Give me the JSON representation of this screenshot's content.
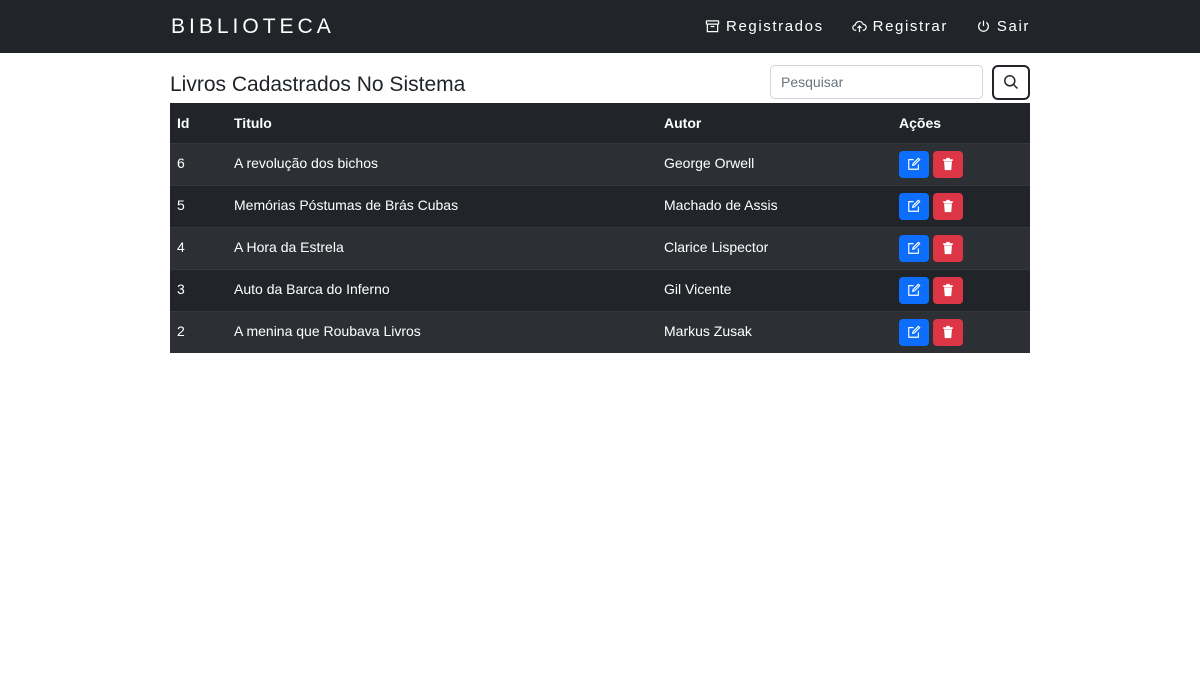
{
  "navbar": {
    "brand": "BIBLIOTECA",
    "links": [
      {
        "label": "Registrados",
        "icon": "archive-icon"
      },
      {
        "label": "Registrar",
        "icon": "cloud-upload-icon"
      },
      {
        "label": "Sair",
        "icon": "power-icon"
      }
    ]
  },
  "main": {
    "title": "Livros Cadastrados No Sistema",
    "search": {
      "placeholder": "Pesquisar",
      "value": ""
    }
  },
  "table": {
    "headers": {
      "id": "Id",
      "title": "Titulo",
      "author": "Autor",
      "actions": "Ações"
    },
    "rows": [
      {
        "id": "6",
        "title": "A revolução dos bichos",
        "author": "George Orwell"
      },
      {
        "id": "5",
        "title": "Memórias Póstumas de Brás Cubas",
        "author": "Machado de Assis"
      },
      {
        "id": "4",
        "title": "A Hora da Estrela",
        "author": "Clarice Lispector"
      },
      {
        "id": "3",
        "title": "Auto da Barca do Inferno",
        "author": "Gil Vicente"
      },
      {
        "id": "2",
        "title": "A menina que Roubava Livros",
        "author": "Markus Zusak"
      }
    ]
  },
  "colors": {
    "navbar": "#212529",
    "edit_button": "#0d6efd",
    "delete_button": "#dc3545",
    "row_odd": "#2c3034",
    "row_even": "#212529"
  }
}
